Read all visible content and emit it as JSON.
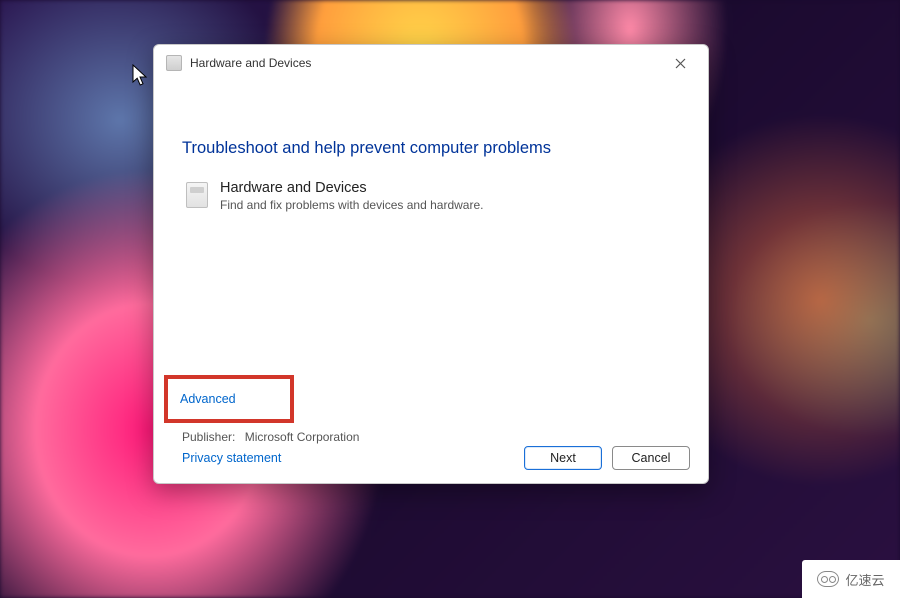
{
  "dialog": {
    "title": "Hardware and Devices",
    "heading": "Troubleshoot and help prevent computer problems",
    "troubleshooter": {
      "name": "Hardware and Devices",
      "description": "Find and fix problems with devices and hardware."
    },
    "advanced_link": "Advanced",
    "publisher_label": "Publisher:",
    "publisher_value": "Microsoft Corporation",
    "privacy_link": "Privacy statement",
    "buttons": {
      "next": "Next",
      "cancel": "Cancel"
    }
  },
  "highlight": {
    "target": "advanced-link",
    "color": "#d2362a"
  },
  "watermark": {
    "text": "亿速云"
  }
}
